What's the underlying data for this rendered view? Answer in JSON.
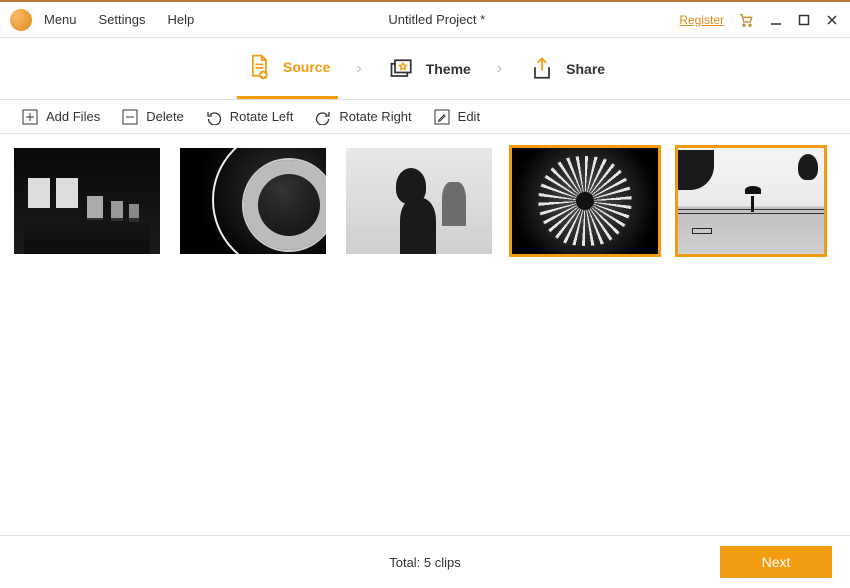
{
  "menu": {
    "menu": "Menu",
    "settings": "Settings",
    "help": "Help"
  },
  "title": "Untitled Project *",
  "register": "Register",
  "steps": {
    "source": "Source",
    "theme": "Theme",
    "share": "Share"
  },
  "toolbar": {
    "add_files": "Add Files",
    "delete": "Delete",
    "rotate_left": "Rotate Left",
    "rotate_right": "Rotate Right",
    "edit": "Edit"
  },
  "footer": {
    "total": "Total: 5 clips",
    "next": "Next"
  },
  "clips": [
    {
      "name": "gallery-room",
      "selected": false
    },
    {
      "name": "ferris-wheel",
      "selected": false
    },
    {
      "name": "silhouette",
      "selected": false
    },
    {
      "name": "flower-macro",
      "selected": true
    },
    {
      "name": "rainy-walk",
      "selected": true
    }
  ]
}
